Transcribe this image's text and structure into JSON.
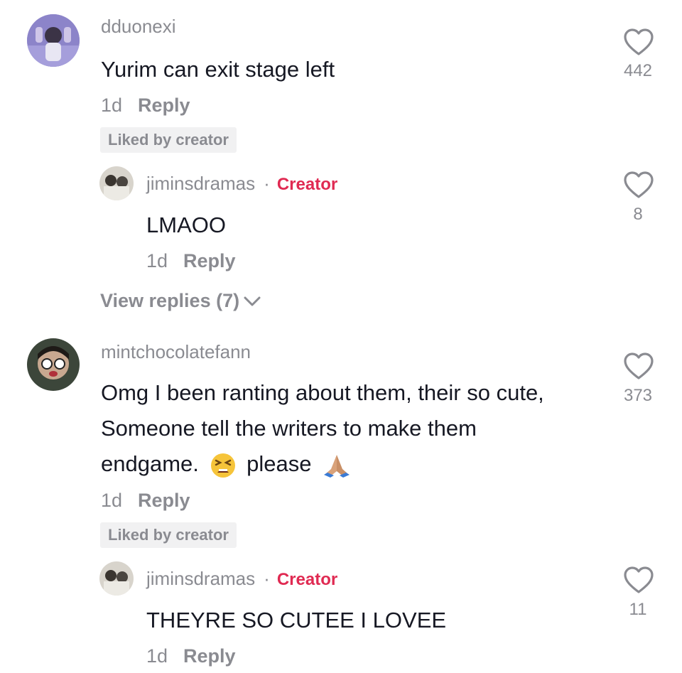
{
  "comments": [
    {
      "username": "dduonexi",
      "text": "Yurim can exit stage left",
      "time": "1d",
      "reply_label": "Reply",
      "badge": "Liked by creator",
      "likes": "442",
      "avatar_color": "#7a6fb8",
      "reply": {
        "username": "jiminsdramas",
        "separator": "·",
        "role": "Creator",
        "text": "LMAOO",
        "time": "1d",
        "reply_label": "Reply",
        "likes": "8"
      },
      "view_replies": "View replies (7)"
    },
    {
      "username": "mintchocolatefann",
      "text_lines": [
        "Omg I been ranting about them, their so cute,",
        "Someone tell the writers to make them",
        "endgame.",
        "please"
      ],
      "time": "1d",
      "reply_label": "Reply",
      "badge": "Liked by creator",
      "likes": "373",
      "avatar_color": "#3d4a3b",
      "reply": {
        "username": "jiminsdramas",
        "separator": "·",
        "role": "Creator",
        "text": "THEYRE SO CUTEE I LOVEE",
        "time": "1d",
        "reply_label": "Reply",
        "likes": "11"
      }
    }
  ],
  "colors": {
    "creator_accent": "#e02a52",
    "muted": "#8a8b91",
    "text": "#161823",
    "badge_bg": "#f1f1f2"
  },
  "icons": {
    "like": "heart-outline-icon",
    "expand": "chevron-down-icon",
    "emoji_1": "tired-face-emoji",
    "emoji_2": "folded-hands-emoji"
  }
}
